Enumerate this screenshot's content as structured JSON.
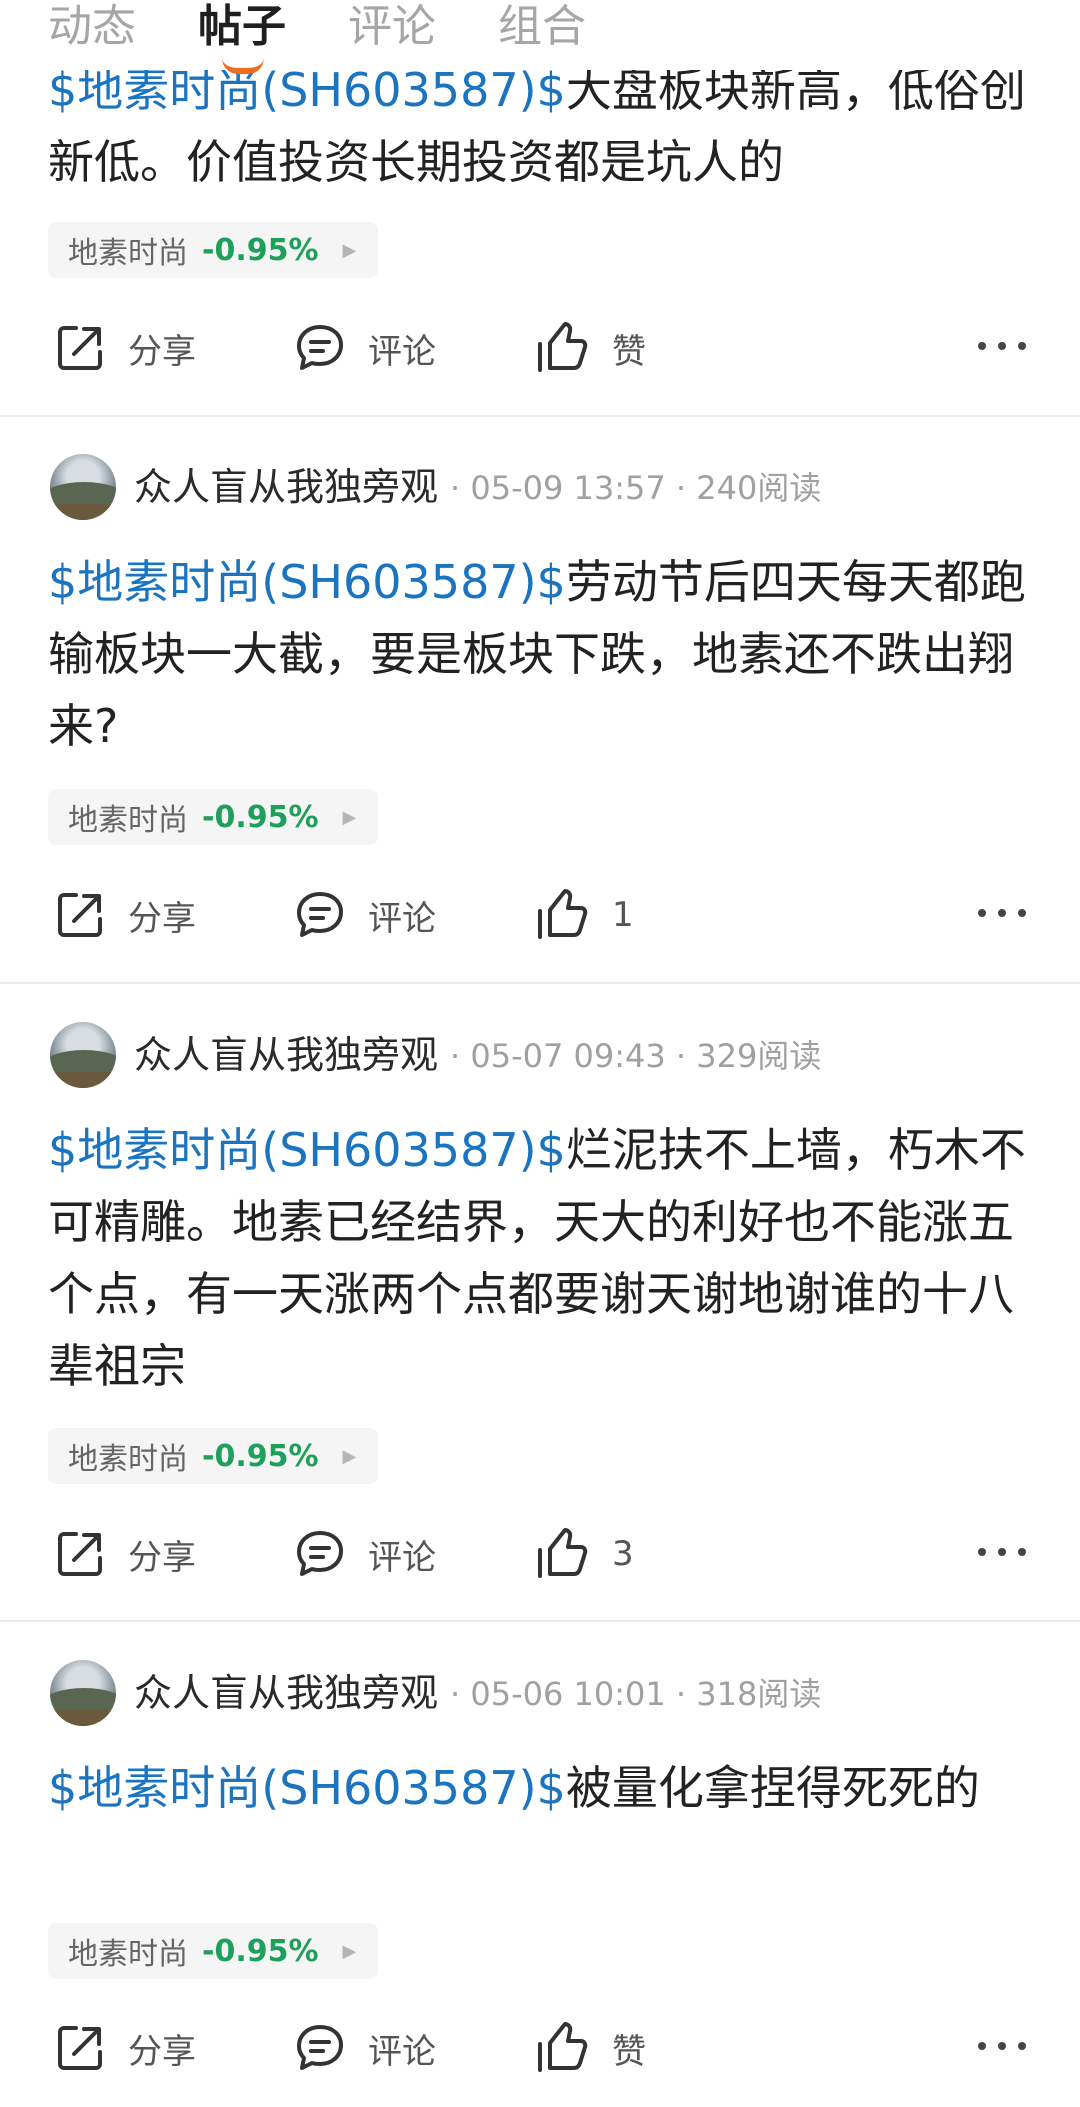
{
  "tabs": [
    {
      "label": "动态"
    },
    {
      "label": "帖子"
    },
    {
      "label": "评论"
    },
    {
      "label": "组合"
    }
  ],
  "colors": {
    "accent": "#f26a1b",
    "link": "#1a74c0",
    "stock_down": "#1ea05a"
  },
  "posts": [
    {
      "body_tag": "$地素时尚(SH603587)$",
      "body_text": "大盘板块新高，低俗创新低。价值投资长期投资都是坑人的",
      "stock": {
        "name": "地素时尚",
        "change": "-0.95%"
      },
      "actions": {
        "share": "分享",
        "comment": "评论",
        "like": "赞"
      }
    },
    {
      "author": "众人盲从我独旁观",
      "meta": "· 05-09 13:57 · 240阅读",
      "body_tag": "$地素时尚(SH603587)$",
      "body_text": "劳动节后四天每天都跑输板块一大截，要是板块下跌，地素还不跌出翔来?",
      "stock": {
        "name": "地素时尚",
        "change": "-0.95%"
      },
      "actions": {
        "share": "分享",
        "comment": "评论",
        "like": "1"
      }
    },
    {
      "author": "众人盲从我独旁观",
      "meta": "· 05-07 09:43 · 329阅读",
      "body_tag": "$地素时尚(SH603587)$",
      "body_text": "烂泥扶不上墙，朽木不可精雕。地素已经结界，天大的利好也不能涨五个点，有一天涨两个点都要谢天谢地谢谁的十八辈祖宗",
      "stock": {
        "name": "地素时尚",
        "change": "-0.95%"
      },
      "actions": {
        "share": "分享",
        "comment": "评论",
        "like": "3"
      }
    },
    {
      "author": "众人盲从我独旁观",
      "meta": "· 05-06 10:01 · 318阅读",
      "body_tag": "$地素时尚(SH603587)$",
      "body_text": "被量化拿捏得死死的",
      "stock": {
        "name": "地素时尚",
        "change": "-0.95%"
      },
      "actions": {
        "share": "分享",
        "comment": "评论",
        "like": "赞"
      }
    }
  ],
  "icons": {
    "share": "share-icon",
    "comment": "comment-icon",
    "like": "thumbs-up-icon",
    "more": "more-icon"
  }
}
